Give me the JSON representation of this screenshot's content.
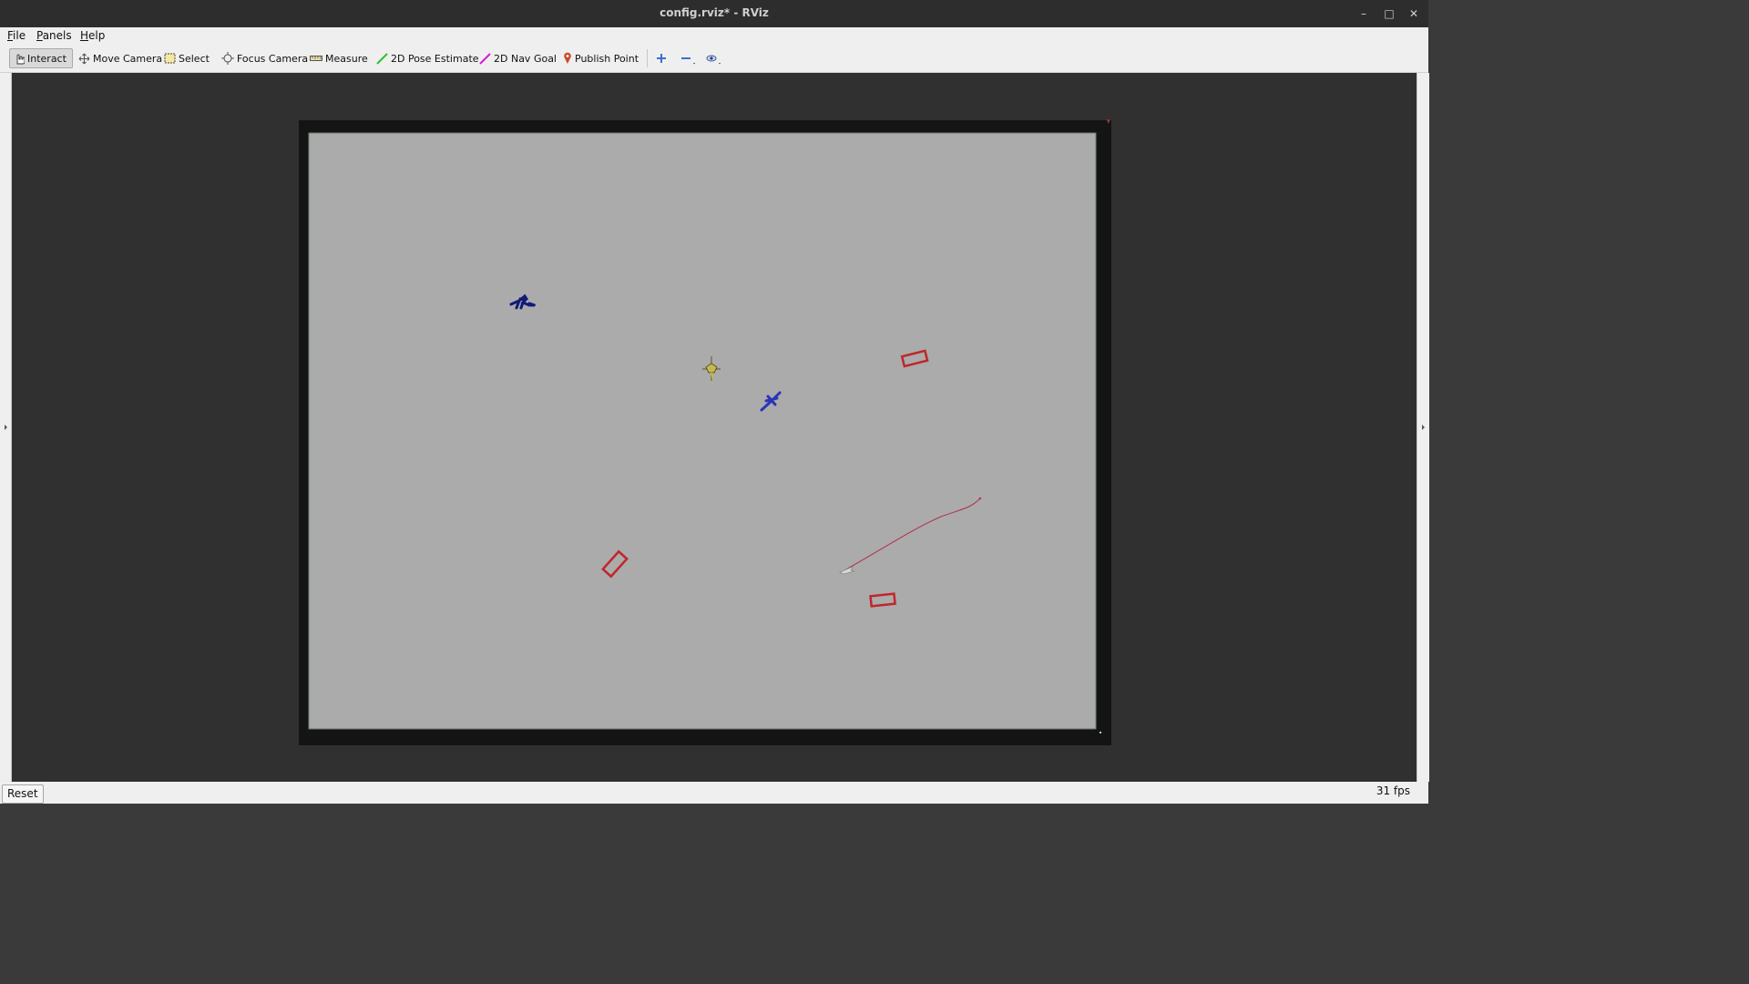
{
  "window": {
    "title": "config.rviz* - RViz",
    "minimize_icon": "minimize-icon",
    "maximize_icon": "maximize-icon",
    "close_icon": "close-icon"
  },
  "menu": {
    "items": [
      {
        "label": "File",
        "underline": "F",
        "rest": "ile"
      },
      {
        "label": "Panels",
        "underline": "P",
        "rest": "anels"
      },
      {
        "label": "Help",
        "underline": "H",
        "rest": "elp"
      }
    ]
  },
  "toolbar": {
    "tools": [
      {
        "label": "Interact",
        "icon": "hand-cursor-icon",
        "active": true
      },
      {
        "label": "Move Camera",
        "icon": "move-camera-icon"
      },
      {
        "label": "Select",
        "icon": "select-rectangle-icon"
      },
      {
        "label": "Focus Camera",
        "icon": "focus-camera-icon"
      },
      {
        "label": "Measure",
        "icon": "ruler-icon"
      },
      {
        "label": "2D Pose Estimate",
        "icon": "green-arrow-icon",
        "color": "#2fbf2f"
      },
      {
        "label": "2D Nav Goal",
        "icon": "magenta-arrow-icon",
        "color": "#d81ad8"
      },
      {
        "label": "Publish Point",
        "icon": "map-pin-icon",
        "color": "#c84a2a"
      }
    ],
    "extra_icons": [
      "add-tool-icon",
      "remove-tool-icon",
      "camera-type-icon"
    ]
  },
  "colors": {
    "map_free": "#ababab",
    "map_border": "#141414",
    "obstacle": "#c0262b",
    "path": "#b0304a",
    "robot_dark_blue": "#101a78",
    "robot_blue": "#2a35b8",
    "robot_yellow": "#c8b850"
  },
  "status": {
    "reset_label": "Reset",
    "fps": "31 fps"
  }
}
